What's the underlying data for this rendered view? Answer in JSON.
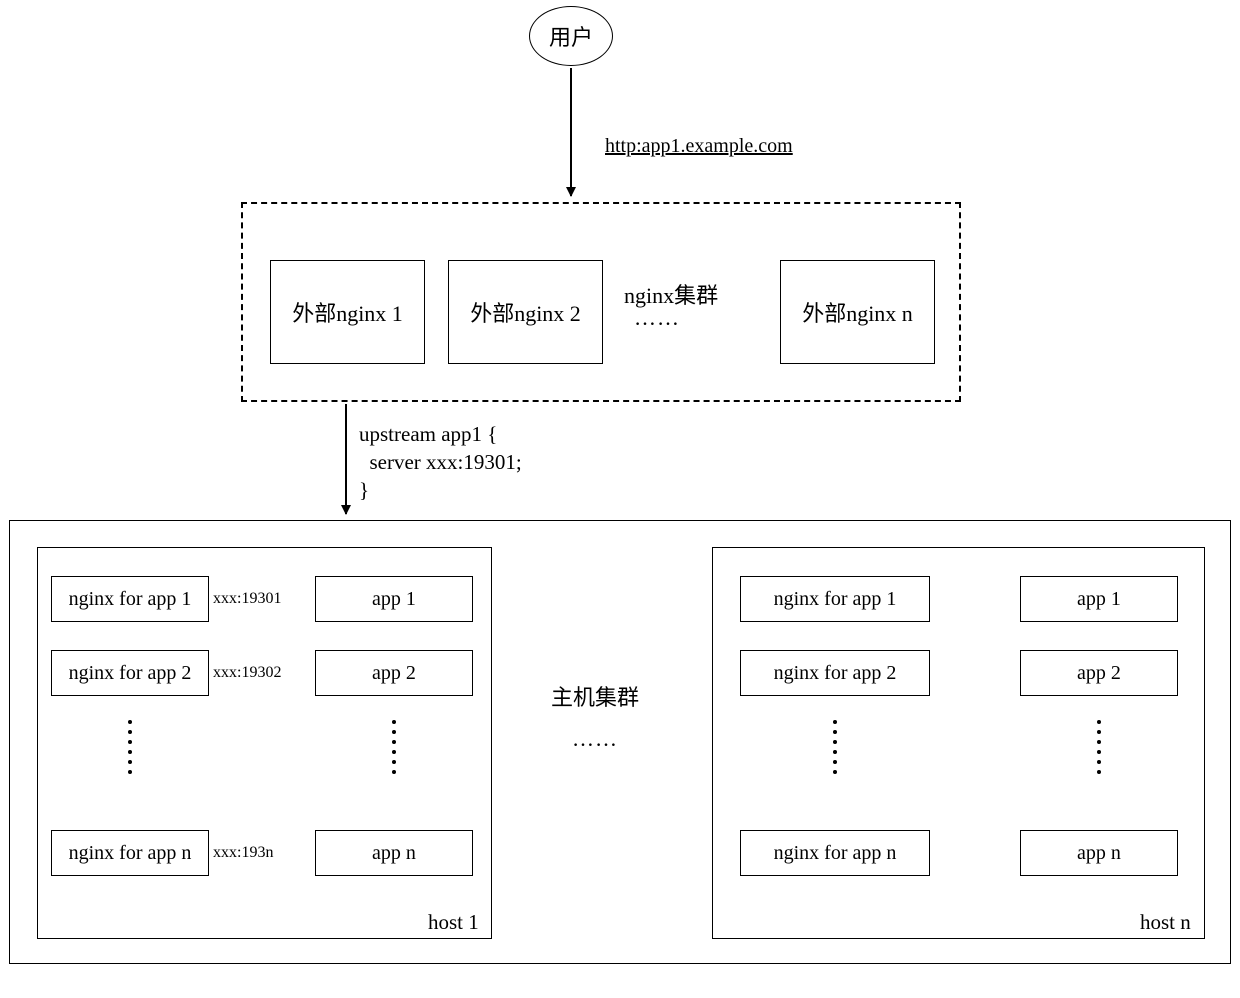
{
  "user_label": "用户",
  "url_label": "http:app1.example.com",
  "nginx_cluster_label": "nginx集群",
  "external_nginx": [
    "外部nginx 1",
    "外部nginx 2",
    "外部nginx n"
  ],
  "dots_h": "……",
  "upstream": {
    "line1": "upstream app1 {",
    "line2": "  server xxx:19301;",
    "line3": "}"
  },
  "host_cluster_label": "主机集群",
  "host1": {
    "title": "host 1",
    "nginx": [
      "nginx for app 1",
      "nginx for app 2",
      "nginx for app n"
    ],
    "ports": [
      "xxx:19301",
      "xxx:19302",
      "xxx:193n"
    ],
    "apps": [
      "app 1",
      "app 2",
      "app n"
    ]
  },
  "hostn": {
    "title": "host n",
    "nginx": [
      "nginx for app 1",
      "nginx for app 2",
      "nginx for app n"
    ],
    "apps": [
      "app 1",
      "app 2",
      "app n"
    ]
  }
}
